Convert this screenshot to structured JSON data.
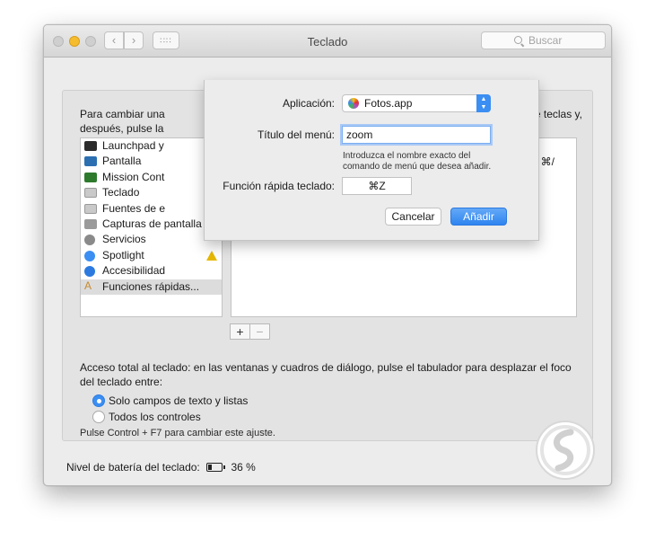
{
  "window": {
    "title": "Teclado",
    "search_placeholder": "Buscar",
    "nav_back": "‹",
    "nav_forward": "›",
    "grid": "∷∷"
  },
  "panel": {
    "description_left_1": "Para cambiar una",
    "description_right_1": "e teclas y,",
    "description_left_2": "después, pulse la",
    "categories": [
      {
        "label": "Launchpad y",
        "icon": "launchpad-icon",
        "color": "#2b2b2b"
      },
      {
        "label": "Pantalla",
        "icon": "display-icon",
        "color": "#2b6fb0"
      },
      {
        "label": "Mission Cont",
        "icon": "mission-control-icon",
        "color": "#2d7a2d"
      },
      {
        "label": "Teclado",
        "icon": "keyboard-icon",
        "color": "#c9c9c9"
      },
      {
        "label": "Fuentes de e",
        "icon": "input-sources-icon",
        "color": "#c9c9c9"
      },
      {
        "label": "Capturas de pantalla",
        "icon": "screenshot-icon",
        "color": "#9a9a9a"
      },
      {
        "label": "Servicios",
        "icon": "gear-icon",
        "color": "#8a8a8a"
      },
      {
        "label": "Spotlight",
        "icon": "spotlight-icon",
        "color": "#3b8ef2"
      },
      {
        "label": "Accesibilidad",
        "icon": "accessibility-icon",
        "color": "#2c7ae0"
      },
      {
        "label": "Funciones rápidas...",
        "icon": "app-shortcuts-icon",
        "color": "#c68a2e"
      }
    ],
    "shortcut_key": "⇧⌘/",
    "plus": "+",
    "minus": "−",
    "kbd_access_text": "Acceso total al teclado: en las ventanas y cuadros de diálogo, pulse el tabulador para desplazar el foco del teclado entre:",
    "radio_1": "Solo campos de texto y listas",
    "radio_2": "Todos los controles",
    "hint": "Pulse Control + F7 para cambiar este ajuste."
  },
  "battery": {
    "label": "Nivel de batería del teclado:",
    "percent": "36 %"
  },
  "sheet": {
    "app_label": "Aplicación:",
    "app_value": "Fotos.app",
    "menu_title_label": "Título del menú:",
    "menu_title_value": "zoom",
    "help_line_1": "Introduzca el nombre exacto del",
    "help_line_2": "comando de menú que desea añadir.",
    "shortcut_label": "Función rápida teclado:",
    "shortcut_value": "⌘Z",
    "cancel": "Cancelar",
    "add": "Añadir"
  }
}
